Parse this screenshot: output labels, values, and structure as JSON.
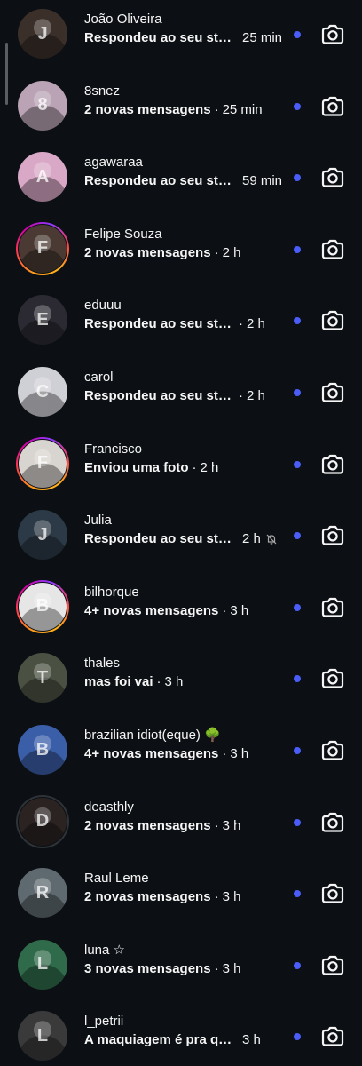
{
  "threads": [
    {
      "name": "João Oliveira",
      "preview": "Respondeu ao seu sto...",
      "sep": "",
      "time": "25 min",
      "ring": "plain",
      "bg": "#3b2f2a",
      "muted": false
    },
    {
      "name": "8snez",
      "preview": "2 novas mensagens",
      "sep": "·",
      "time": "25 min",
      "ring": "plain",
      "bg": "#b9a3b4",
      "muted": false
    },
    {
      "name": "agawaraa",
      "preview": "Respondeu ao seu sto...",
      "sep": "",
      "time": "59 min",
      "ring": "plain",
      "bg": "#d9a8c6",
      "muted": false
    },
    {
      "name": "Felipe Souza",
      "preview": "2 novas mensagens",
      "sep": "·",
      "time": "2 h",
      "ring": "story",
      "bg": "#4a3a33",
      "muted": false
    },
    {
      "name": "eduuu",
      "preview": "Respondeu ao seu story",
      "sep": "·",
      "time": "2 h",
      "ring": "plain",
      "bg": "#2b2a33",
      "muted": false
    },
    {
      "name": "carol",
      "preview": "Respondeu ao seu story",
      "sep": "·",
      "time": "2 h",
      "ring": "plain",
      "bg": "#cfcfd6",
      "muted": false
    },
    {
      "name": "Francisco",
      "preview": "Enviou uma foto",
      "sep": "·",
      "time": "2 h",
      "ring": "story",
      "bg": "#d8d4cf",
      "muted": false
    },
    {
      "name": "Julia",
      "preview": "Respondeu ao seu stor...",
      "sep": "",
      "time": "2 h",
      "ring": "plain",
      "bg": "#2c3946",
      "muted": true
    },
    {
      "name": "bilhorque",
      "preview": "4+ novas mensagens",
      "sep": "·",
      "time": "3 h",
      "ring": "story",
      "bg": "#e6e6e6",
      "muted": false
    },
    {
      "name": "thales",
      "preview": "mas foi vai",
      "sep": "·",
      "time": "3 h",
      "ring": "plain",
      "bg": "#4b5142",
      "muted": false
    },
    {
      "name": "brazilian idiot(eque) 🌳",
      "preview": "4+ novas mensagens",
      "sep": "·",
      "time": "3 h",
      "ring": "plain",
      "bg": "#3a5ea8",
      "muted": false
    },
    {
      "name": "deasthly",
      "preview": "2 novas mensagens",
      "sep": "·",
      "time": "3 h",
      "ring": "seen",
      "bg": "#2a2321",
      "muted": false
    },
    {
      "name": "Raul Leme",
      "preview": "2 novas mensagens",
      "sep": "·",
      "time": "3 h",
      "ring": "plain",
      "bg": "#5e6a6f",
      "muted": false
    },
    {
      "name": "luna ☆",
      "preview": "3 novas mensagens",
      "sep": "·",
      "time": "3 h",
      "ring": "plain",
      "bg": "#2f6b4a",
      "muted": false
    },
    {
      "name": "l_petrii",
      "preview": "A maquiagem é pra quem...",
      "sep": "",
      "time": "3 h",
      "ring": "plain",
      "bg": "#3a3a3a",
      "muted": false
    }
  ],
  "colors": {
    "background": "#0c1014",
    "unread_dot": "#4a5df9",
    "text": "#f5f5f5"
  },
  "icons": {
    "camera": "camera-icon",
    "mute": "bell-slash-icon"
  }
}
